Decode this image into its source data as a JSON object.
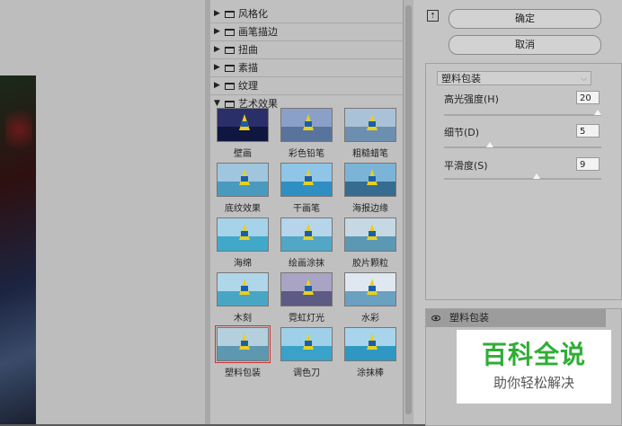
{
  "categories": [
    {
      "label": "风格化",
      "expanded": false
    },
    {
      "label": "画笔描边",
      "expanded": false
    },
    {
      "label": "扭曲",
      "expanded": false
    },
    {
      "label": "素描",
      "expanded": false
    },
    {
      "label": "纹理",
      "expanded": false
    },
    {
      "label": "艺术效果",
      "expanded": true
    }
  ],
  "filters": [
    {
      "label": "壁画"
    },
    {
      "label": "彩色铅笔"
    },
    {
      "label": "粗糙蜡笔"
    },
    {
      "label": "底纹效果"
    },
    {
      "label": "干画笔"
    },
    {
      "label": "海报边缘"
    },
    {
      "label": "海绵"
    },
    {
      "label": "绘画涂抹"
    },
    {
      "label": "胶片颗粒"
    },
    {
      "label": "木刻"
    },
    {
      "label": "霓虹灯光"
    },
    {
      "label": "水彩"
    },
    {
      "label": "塑料包装"
    },
    {
      "label": "调色刀"
    },
    {
      "label": "涂抹棒"
    }
  ],
  "selected_filter": "塑料包装",
  "buttons": {
    "ok": "确定",
    "cancel": "取消"
  },
  "settings": {
    "filter_select": "塑料包装",
    "params": [
      {
        "label": "高光强度(H)",
        "value": "20",
        "level_fraction": 1.0
      },
      {
        "label": "细节(D)",
        "value": "5",
        "level_fraction": 0.3
      },
      {
        "label": "平滑度(S)",
        "value": "9",
        "level_fraction": 0.6
      }
    ]
  },
  "layer": {
    "label": "塑料包装"
  },
  "watermark": {
    "title": "百科全说",
    "subtitle": "助你轻松解决"
  }
}
